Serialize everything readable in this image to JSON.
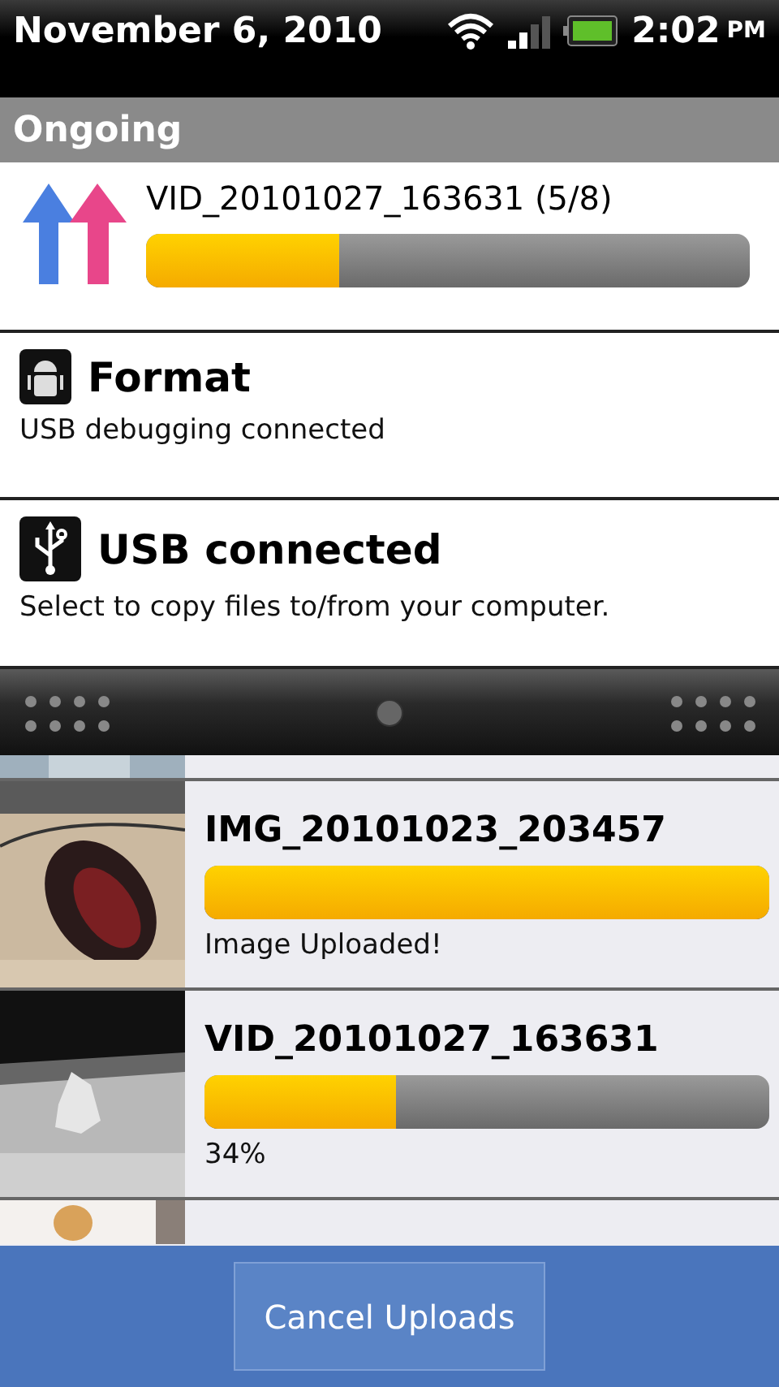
{
  "status_bar": {
    "date": "November 6, 2010",
    "time": "2:02",
    "meridiem": "PM"
  },
  "notifications": {
    "header": "Ongoing",
    "items": [
      {
        "kind": "upload",
        "title": "VID_20101027_163631 (5/8)",
        "level": 0.32
      },
      {
        "kind": "debug",
        "title": "Format",
        "subtitle": "USB debugging connected"
      },
      {
        "kind": "usb",
        "title": "USB connected",
        "subtitle": "Select to copy files to/from your computer."
      }
    ]
  },
  "uploads": [
    {
      "kind": "mouse",
      "title": "IMG_20101023_203457",
      "level": 1,
      "status": "Image Uploaded!"
    },
    {
      "kind": "plastic",
      "title": "VID_20101027_163631",
      "level": 0.34,
      "status": "34%"
    }
  ],
  "cancel_button": "Cancel Uploads"
}
